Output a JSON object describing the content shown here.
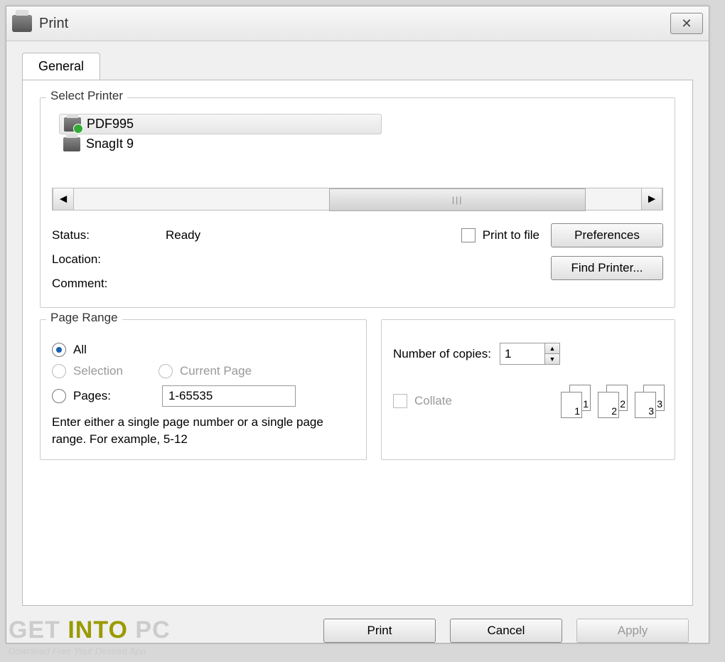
{
  "window": {
    "title": "Print"
  },
  "tabs": {
    "general": "General"
  },
  "selectPrinter": {
    "legend": "Select Printer",
    "printers": [
      {
        "name": "PDF995",
        "default": true
      },
      {
        "name": "SnagIt 9",
        "default": false
      }
    ],
    "statusLabel": "Status:",
    "statusValue": "Ready",
    "locationLabel": "Location:",
    "locationValue": "",
    "commentLabel": "Comment:",
    "commentValue": "",
    "printToFile": "Print to file",
    "preferences": "Preferences",
    "findPrinter": "Find Printer..."
  },
  "pageRange": {
    "legend": "Page Range",
    "all": "All",
    "selection": "Selection",
    "currentPage": "Current Page",
    "pages": "Pages:",
    "pagesValue": "1-65535",
    "help": "Enter either a single page number or a single page range.  For example, 5-12"
  },
  "copies": {
    "numberLabel": "Number of copies:",
    "numberValue": "1",
    "collate": "Collate",
    "pairs": [
      "1",
      "2",
      "3"
    ]
  },
  "actions": {
    "print": "Print",
    "cancel": "Cancel",
    "apply": "Apply"
  },
  "watermark": {
    "part1": "GET",
    "part2": "INTO",
    "part3": "PC",
    "subtitle": "Download Free Your Desired App"
  }
}
